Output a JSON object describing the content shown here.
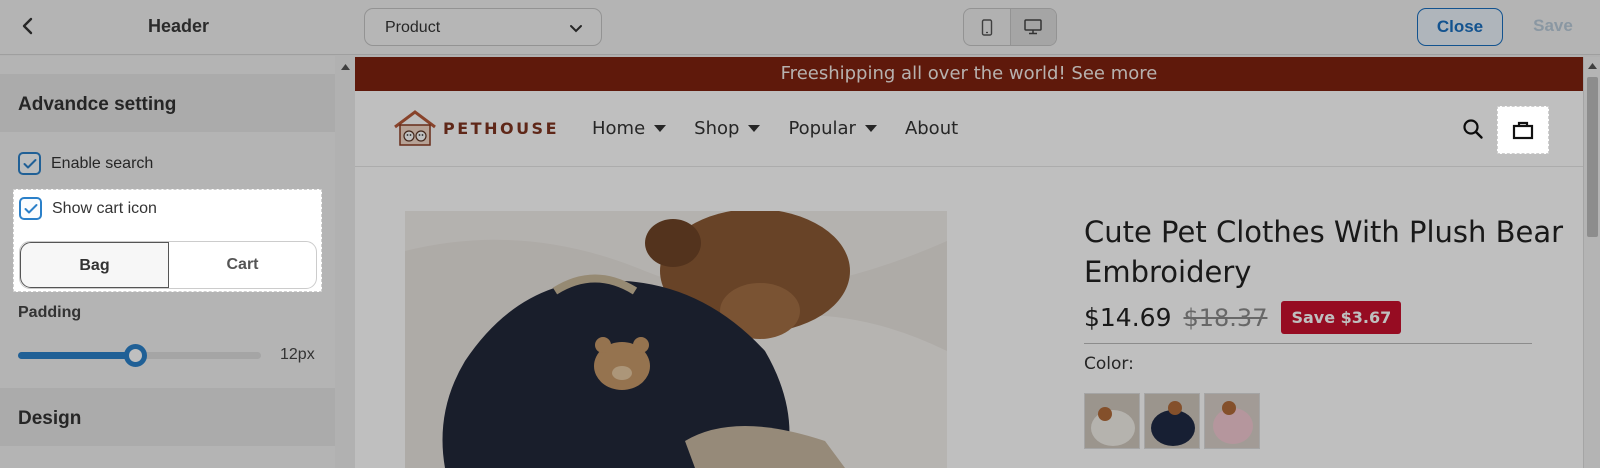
{
  "topbar": {
    "title": "Header",
    "page_select": "Product",
    "close_label": "Close",
    "save_label": "Save"
  },
  "sidebar": {
    "advanced_heading": "Advandce setting",
    "enable_search": {
      "label": "Enable search",
      "checked": true
    },
    "show_cart_icon": {
      "label": "Show cart icon",
      "checked": true
    },
    "cart_style": {
      "options": [
        "Bag",
        "Cart"
      ],
      "selected": "Bag"
    },
    "padding": {
      "label": "Padding",
      "value_text": "12px",
      "fraction": 0.48
    },
    "design_heading": "Design"
  },
  "preview": {
    "announcement": "Freeshipping all over the world! See more",
    "logo_text": "PETHOUSE",
    "nav": [
      {
        "label": "Home",
        "has_dropdown": true
      },
      {
        "label": "Shop",
        "has_dropdown": true
      },
      {
        "label": "Popular",
        "has_dropdown": true
      },
      {
        "label": "About",
        "has_dropdown": false
      }
    ],
    "product": {
      "title": "Cute Pet Clothes With Plush Bear Embroidery",
      "price": "$14.69",
      "compare_price": "$18.37",
      "save_badge": "Save $3.67",
      "color_label": "Color:"
    }
  },
  "colors": {
    "accent": "#2b80c9",
    "announcement_bg": "#7f220f",
    "badge": "#c8102e"
  }
}
